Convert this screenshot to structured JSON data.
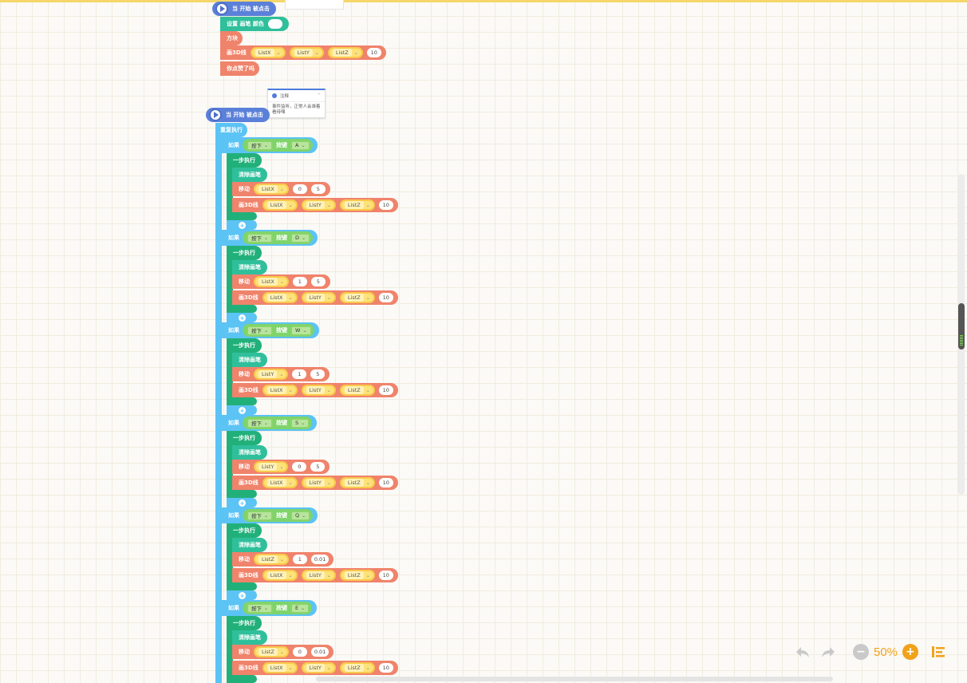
{
  "colors": {
    "hat": "#5b80d9",
    "pen": "#2fbf9b",
    "draw": "#f0836b",
    "loop": "#5cc3f5",
    "step": "#22b07a",
    "accent": "#f0a31a"
  },
  "script1": {
    "hat": "当 开始 被点击",
    "set_pen": "设置 画笔 颜色",
    "cube": "方块",
    "draw3d": "画3D线",
    "args": [
      "ListX",
      "ListY",
      "ListZ"
    ],
    "num": "10",
    "ask": "你点赞了吗"
  },
  "note": {
    "title": "注释",
    "body": "事件监听，正常人会准着看待嘿"
  },
  "script2": {
    "hat": "当 开始 被点击",
    "repeat": "重复执行",
    "if_label": "如果",
    "press": "按下",
    "key_label": "按键",
    "step": "一步执行",
    "clear": "清除画笔",
    "move": "移动",
    "draw3d": "画3D线",
    "args": [
      "ListX",
      "ListY",
      "ListZ"
    ],
    "num": "10",
    "branches": [
      {
        "key": "A",
        "axis": "ListX",
        "val1": "0",
        "val2": "5"
      },
      {
        "key": "D",
        "axis": "ListX",
        "val1": "1",
        "val2": "5"
      },
      {
        "key": "W",
        "axis": "ListY",
        "val1": "1",
        "val2": "5"
      },
      {
        "key": "S",
        "axis": "ListY",
        "val1": "0",
        "val2": "5"
      },
      {
        "key": "Q",
        "axis": "ListZ",
        "val1": "1",
        "val2": "0.01"
      },
      {
        "key": "E",
        "axis": "ListZ",
        "val1": "0",
        "val2": "0.01"
      }
    ]
  },
  "zoom": {
    "level": "50%"
  }
}
